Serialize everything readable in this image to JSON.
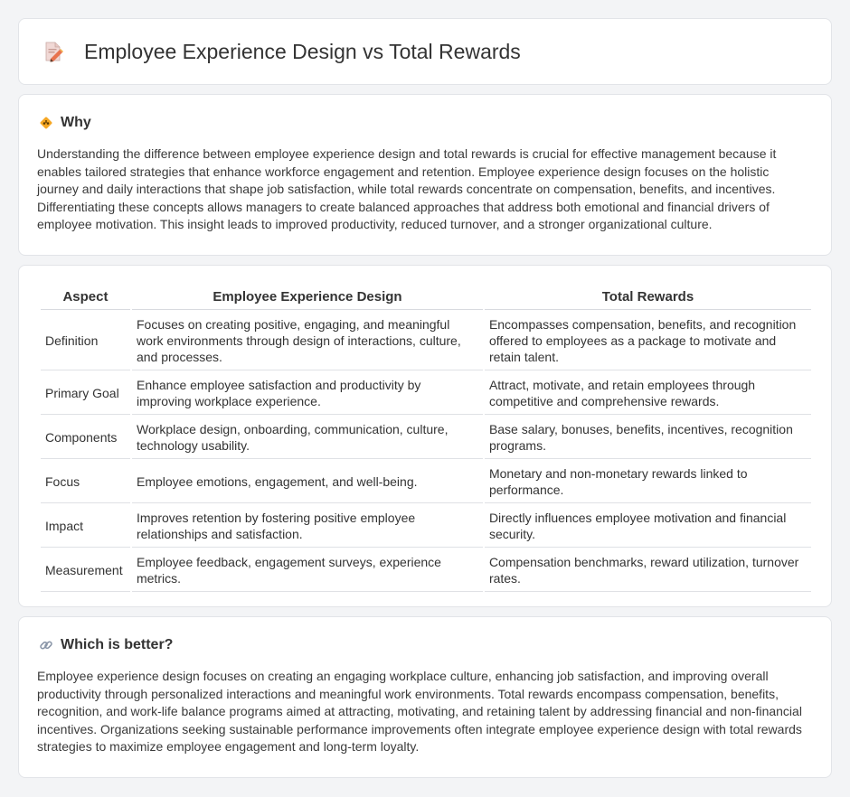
{
  "header": {
    "title": "Employee Experience Design vs Total Rewards",
    "icon": "document-pencil-icon"
  },
  "why": {
    "heading": "Why",
    "icon": "diamond-warning-icon",
    "text": "Understanding the difference between employee experience design and total rewards is crucial for effective management because it enables tailored strategies that enhance workforce engagement and retention. Employee experience design focuses on the holistic journey and daily interactions that shape job satisfaction, while total rewards concentrate on compensation, benefits, and incentives. Differentiating these concepts allows managers to create balanced approaches that address both emotional and financial drivers of employee motivation. This insight leads to improved productivity, reduced turnover, and a stronger organizational culture."
  },
  "table": {
    "headers": [
      "Aspect",
      "Employee Experience Design",
      "Total Rewards"
    ],
    "rows": [
      {
        "aspect": "Definition",
        "a": "Focuses on creating positive, engaging, and meaningful work environments through design of interactions, culture, and processes.",
        "b": "Encompasses compensation, benefits, and recognition offered to employees as a package to motivate and retain talent."
      },
      {
        "aspect": "Primary Goal",
        "a": "Enhance employee satisfaction and productivity by improving workplace experience.",
        "b": "Attract, motivate, and retain employees through competitive and comprehensive rewards."
      },
      {
        "aspect": "Components",
        "a": "Workplace design, onboarding, communication, culture, technology usability.",
        "b": "Base salary, bonuses, benefits, incentives, recognition programs."
      },
      {
        "aspect": "Focus",
        "a": "Employee emotions, engagement, and well-being.",
        "b": "Monetary and non-monetary rewards linked to performance."
      },
      {
        "aspect": "Impact",
        "a": "Improves retention by fostering positive employee relationships and satisfaction.",
        "b": "Directly influences employee motivation and financial security."
      },
      {
        "aspect": "Measurement",
        "a": "Employee feedback, engagement surveys, experience metrics.",
        "b": "Compensation benchmarks, reward utilization, turnover rates."
      }
    ]
  },
  "better": {
    "heading": "Which is better?",
    "icon": "link-icon",
    "text": "Employee experience design focuses on creating an engaging workplace culture, enhancing job satisfaction, and improving overall productivity through personalized interactions and meaningful work environments. Total rewards encompass compensation, benefits, recognition, and work-life balance programs aimed at attracting, motivating, and retaining talent by addressing financial and non-financial incentives. Organizations seeking sustainable performance improvements often integrate employee experience design with total rewards strategies to maximize employee engagement and long-term loyalty."
  }
}
